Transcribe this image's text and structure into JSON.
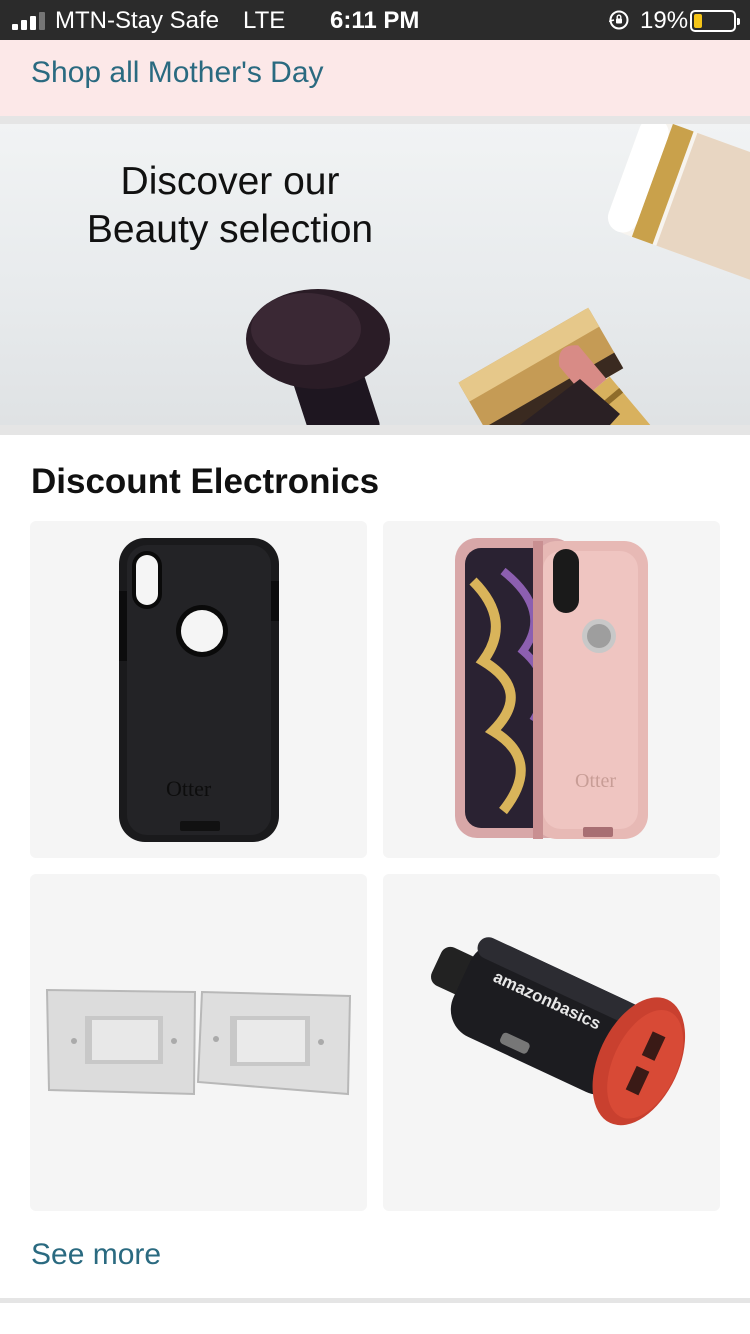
{
  "status_bar": {
    "carrier": "MTN-Stay Safe",
    "network": "LTE",
    "time": "6:11 PM",
    "battery_percent": "19%",
    "battery_level": 0.19,
    "signal_bars": 3,
    "icons": [
      "signal-icon",
      "orientation-lock-icon",
      "battery-icon"
    ]
  },
  "promo_link": {
    "label": "Shop all Mother's Day",
    "background": "#fce8e8",
    "color": "#2a6a80"
  },
  "beauty_banner": {
    "title_line1": "Discover our",
    "title_line2": "Beauty selection"
  },
  "electronics": {
    "title": "Discount Electronics",
    "products": [
      {
        "image": "black-otter-phone-case",
        "brand_mark": "Otter"
      },
      {
        "image": "pink-otter-phone-case",
        "brand_mark": "Otter"
      },
      {
        "image": "recessed-wall-plates",
        "brand_mark": ""
      },
      {
        "image": "amazonbasics-car-charger",
        "brand_mark": "amazonbasics"
      }
    ],
    "see_more": "See more"
  }
}
